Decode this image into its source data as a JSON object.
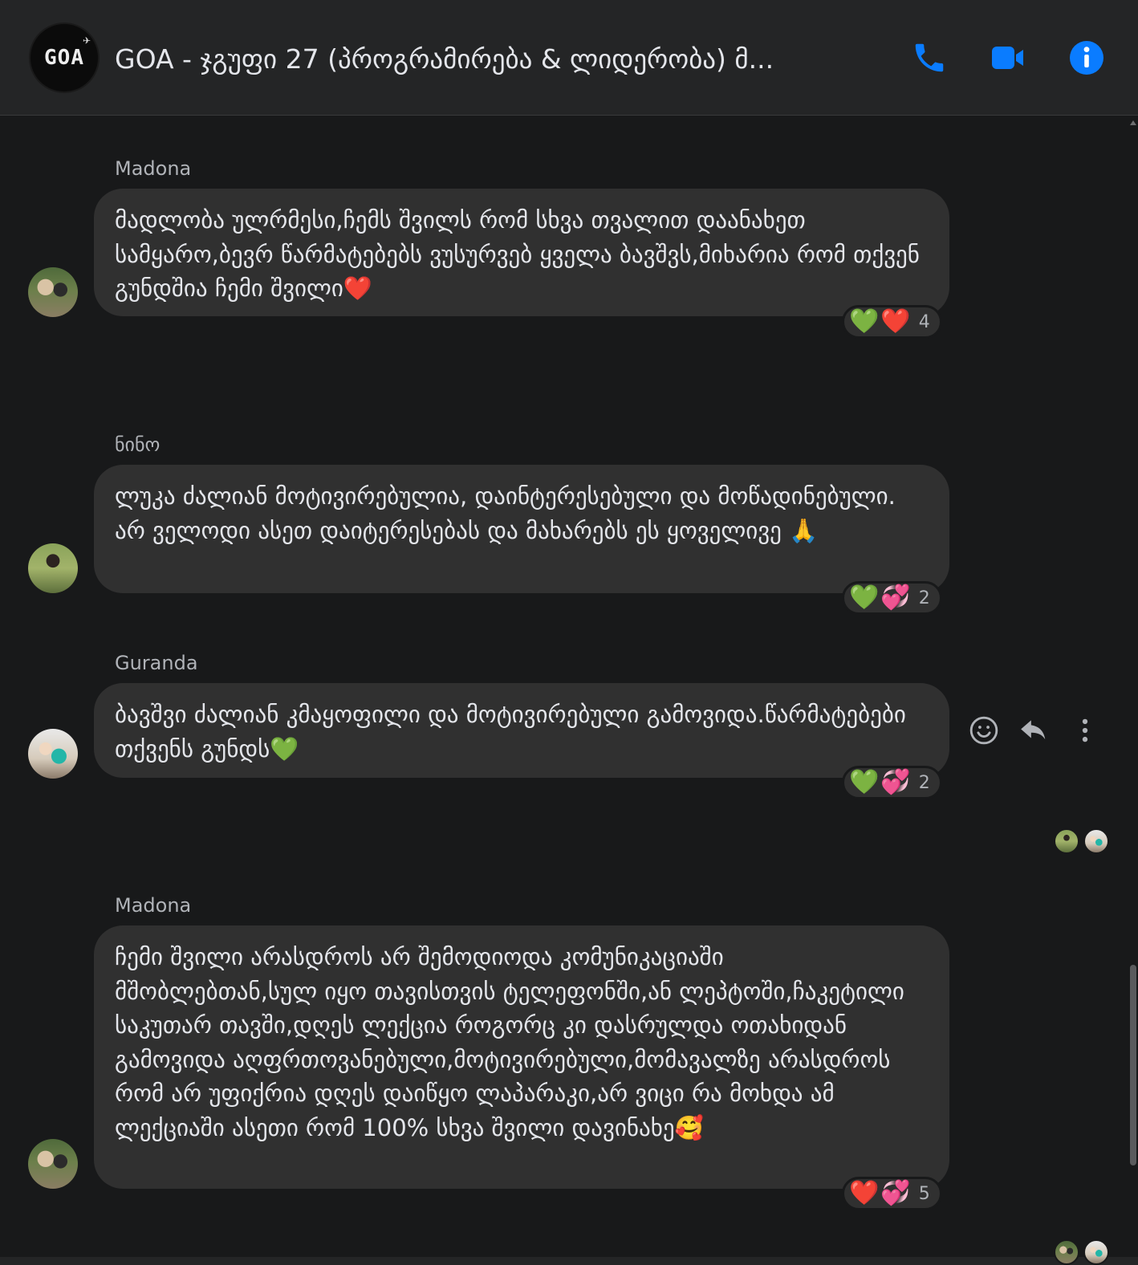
{
  "header": {
    "group_avatar_text": "GOA",
    "title": "GOA - ჯგუფი 27 (პროგრამირება & ლიდერობა) მ..."
  },
  "colors": {
    "accent": "#0a7cff",
    "background": "#18191a",
    "bubble": "#303030"
  },
  "messages": [
    {
      "sender": "Madona",
      "text": "მადლობა ულრმესი,ჩემს  შვილს რომ სხვა თვალით დაანახეთ სამყარო,ბევრ წარმატებებს ვუსურვებ ყველა ბავშვს,მიხარია რომ თქვენ გუნდშია ჩემი შვილი❤️",
      "reactions": [
        "💚",
        "❤️"
      ],
      "reaction_count": "4"
    },
    {
      "sender": "ნინო",
      "text": "ლუკა ძალიან მოტივირებულია, დაინტერესებული და მოწადინებული. არ ველოდი ასეთ დაიტერესებას და მახარებს ეს ყოველივე 🙏",
      "reactions": [
        "💚",
        "💞"
      ],
      "reaction_count": "2"
    },
    {
      "sender": "Guranda",
      "text": "ბავშვი ძალიან კმაყოფილი და მოტივირებული გამოვიდა.წარმატებები თქვენს გუნდს💚",
      "reactions": [
        "💚",
        "💞"
      ],
      "reaction_count": "2"
    },
    {
      "sender": "Madona",
      "text": "ჩემი შვილი არასდროს არ შემოდიოდა კომუნიკაციაში მშობლებთან,სულ იყო თავისთვის ტელეფონში,ან ლეპტოში,ჩაკეტილი საკუთარ თავში,დღეს ლექცია როგორც კი დასრულდა ოთახიდან გამოვიდა აღფრთოვანებული,მოტივირებული,მომავალზე არასდროს რომ არ უფიქრია დღეს დაიწყო ლაპარაკი,არ ვიცი რა მოხდა ამ ლექციაში ასეთი რომ 100% სხვა შვილი დავინახე🥰",
      "reactions": [
        "❤️",
        "💞"
      ],
      "reaction_count": "5"
    }
  ]
}
